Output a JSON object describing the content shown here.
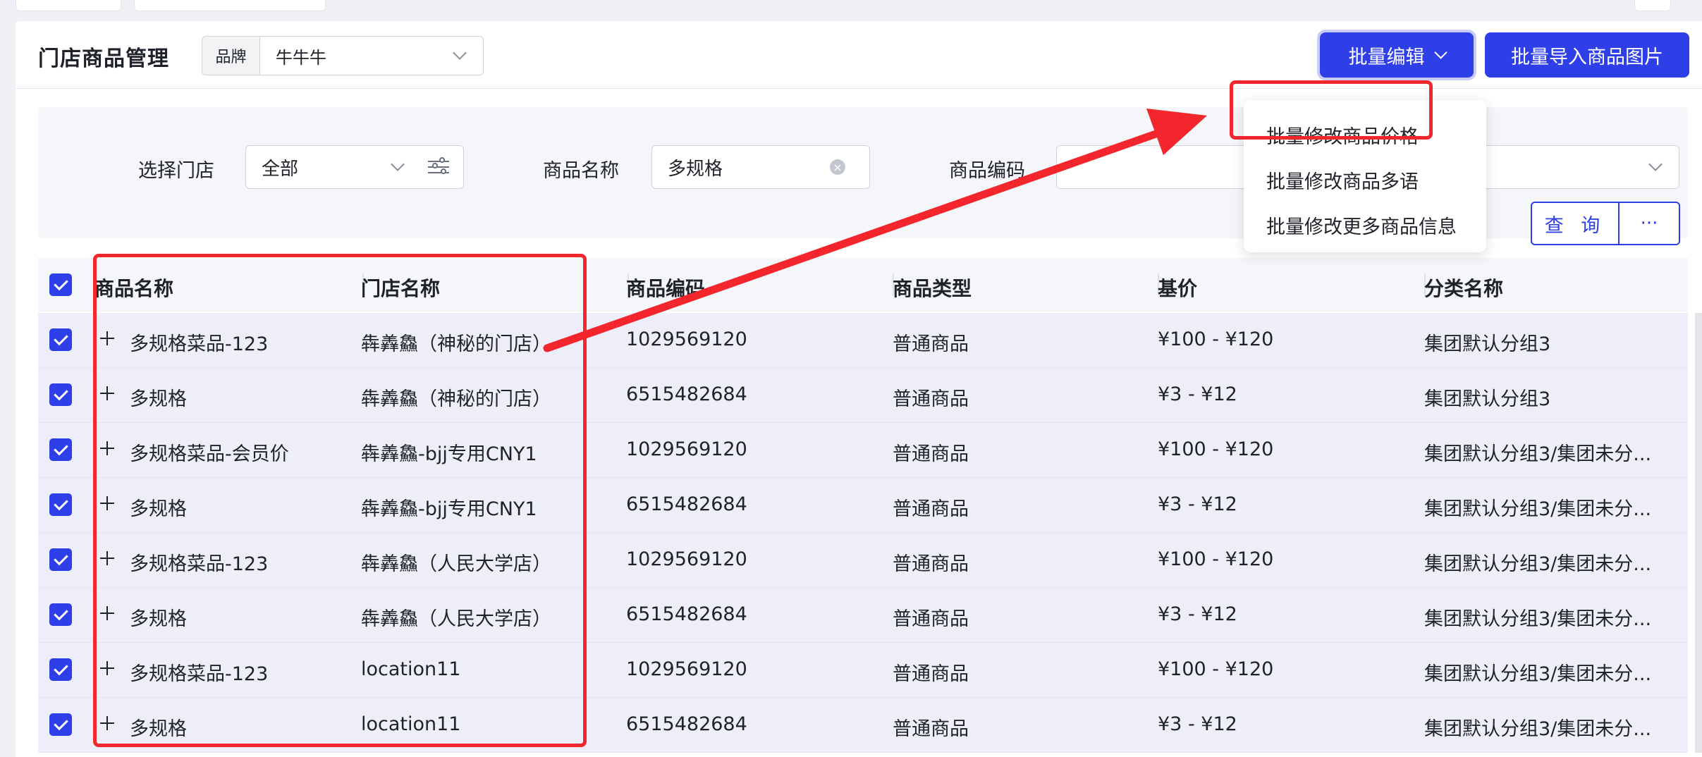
{
  "header": {
    "title": "门店商品管理",
    "brand_label": "品牌",
    "brand_value": "牛牛牛",
    "batch_edit_label": "批量编辑",
    "batch_import_label": "批量导入商品图片"
  },
  "filters": {
    "store_label": "选择门店",
    "store_value": "全部",
    "name_label": "商品名称",
    "name_value": "多规格",
    "code_label": "商品编码",
    "code_value": "",
    "query_label": "查 询",
    "more_label": "···"
  },
  "batch_menu": {
    "items": [
      "批量修改商品价格",
      "批量修改商品多语",
      "批量修改更多商品信息"
    ]
  },
  "table": {
    "columns": [
      "商品名称",
      "门店名称",
      "商品编码",
      "商品类型",
      "基价",
      "分类名称"
    ],
    "rows": [
      {
        "name": "多规格菜品-123",
        "store": "犇羴鱻（神秘的门店）",
        "code": "1029569120",
        "type": "普通商品",
        "price": "¥100 - ¥120",
        "category": "集团默认分组3"
      },
      {
        "name": "多规格",
        "store": "犇羴鱻（神秘的门店）",
        "code": "6515482684",
        "type": "普通商品",
        "price": "¥3 - ¥12",
        "category": "集团默认分组3"
      },
      {
        "name": "多规格菜品-会员价",
        "store": "犇羴鱻-bjj专用CNY1",
        "code": "1029569120",
        "type": "普通商品",
        "price": "¥100 - ¥120",
        "category": "集团默认分组3/集团未分..."
      },
      {
        "name": "多规格",
        "store": "犇羴鱻-bjj专用CNY1",
        "code": "6515482684",
        "type": "普通商品",
        "price": "¥3 - ¥12",
        "category": "集团默认分组3/集团未分..."
      },
      {
        "name": "多规格菜品-123",
        "store": "犇羴鱻（人民大学店）",
        "code": "1029569120",
        "type": "普通商品",
        "price": "¥100 - ¥120",
        "category": "集团默认分组3/集团未分..."
      },
      {
        "name": "多规格",
        "store": "犇羴鱻（人民大学店）",
        "code": "6515482684",
        "type": "普通商品",
        "price": "¥3 - ¥12",
        "category": "集团默认分组3/集团未分..."
      },
      {
        "name": "多规格菜品-123",
        "store": "location11",
        "code": "1029569120",
        "type": "普通商品",
        "price": "¥100 - ¥120",
        "category": "集团默认分组3/集团未分..."
      },
      {
        "name": "多规格",
        "store": "location11",
        "code": "6515482684",
        "type": "普通商品",
        "price": "¥3 - ¥12",
        "category": "集团默认分组3/集团未分..."
      }
    ]
  },
  "colors": {
    "primary": "#2e3fe8",
    "annotation_red": "#f2262c",
    "row_selected_bg": "#eeeefb"
  },
  "icons": [
    "chevron-down-icon",
    "clear-icon",
    "filter-settings-icon",
    "expand-plus-icon",
    "checkbox-checked-icon"
  ]
}
